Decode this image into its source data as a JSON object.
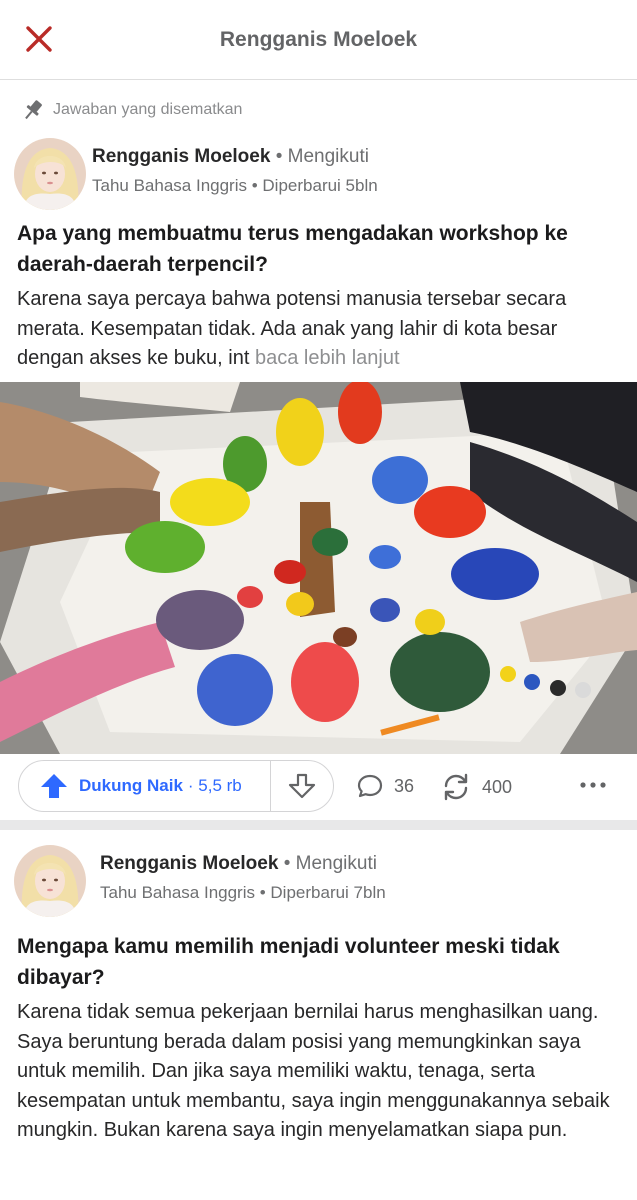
{
  "topbar": {
    "title": "Rengganis Moeloek",
    "close_icon": "close-icon",
    "accent": "#b92b27"
  },
  "pinned": {
    "icon": "pin-icon",
    "label": "Jawaban yang disematkan"
  },
  "posts": [
    {
      "author": "Rengganis Moeloek",
      "follow_label": "• Mengikuti",
      "credential": "Tahu Bahasa Inggris",
      "updated": "• Diperbarui 5bln",
      "question": "Apa yang membuatmu terus mengadakan workshop ke daerah-daerah terpencil?",
      "answer": "Karena saya percaya bahwa potensi manusia tersebar secara merata. Kesempatan tidak. Ada anak yang lahir di kota besar dengan akses ke buku, int",
      "read_more": "baca lebih lanjut",
      "actions": {
        "upvote_label": "Dukung Naik",
        "upvote_count": "· 5,5 rb",
        "comments": "36",
        "shares": "400"
      }
    },
    {
      "author": "Rengganis Moeloek",
      "follow_label": "• Mengikuti",
      "credential": "Tahu Bahasa Inggris",
      "updated": "• Diperbarui 7bln",
      "question": "Mengapa kamu memilih menjadi volunteer meski tidak dibayar?",
      "answer": "Karena tidak semua pekerjaan bernilai harus menghasilkan uang. Saya beruntung berada dalam posisi yang memungkinkan saya untuk memilih. Dan jika saya memiliki waktu, tenaga, serta kesempatan untuk membantu, saya ingin menggunakannya sebaik mungkin. Bukan karena saya ingin menyelamatkan siapa pun."
    }
  ],
  "colors": {
    "upvote_blue": "#2e69ff",
    "meta_gray": "#6e6f71"
  }
}
